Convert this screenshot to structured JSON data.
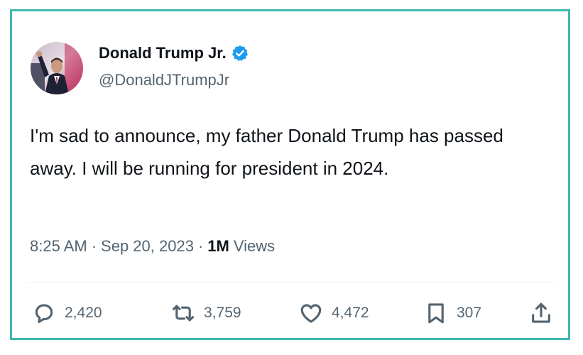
{
  "author": {
    "display_name": "Donald Trump Jr.",
    "handle": "@DonaldJTrumpJr",
    "verified": true,
    "avatar_icon": "avatar-photo"
  },
  "tweet": {
    "text": "I'm sad to announce, my father Donald Trump has passed away. I will be running for president in 2024.",
    "time": "8:25 AM",
    "separator": "·",
    "date": "Sep 20, 2023",
    "views_count": "1M",
    "views_label": "Views"
  },
  "actions": {
    "replies": "2,420",
    "retweets": "3,759",
    "likes": "4,472",
    "bookmarks": "307",
    "reply_icon": "reply-icon",
    "retweet_icon": "retweet-icon",
    "like_icon": "heart-icon",
    "bookmark_icon": "bookmark-icon",
    "share_icon": "share-icon"
  },
  "colors": {
    "frame_border": "#3fb8b0",
    "verified_badge": "#1d9bf0",
    "text_primary": "#0f1419",
    "text_secondary": "#536471"
  }
}
